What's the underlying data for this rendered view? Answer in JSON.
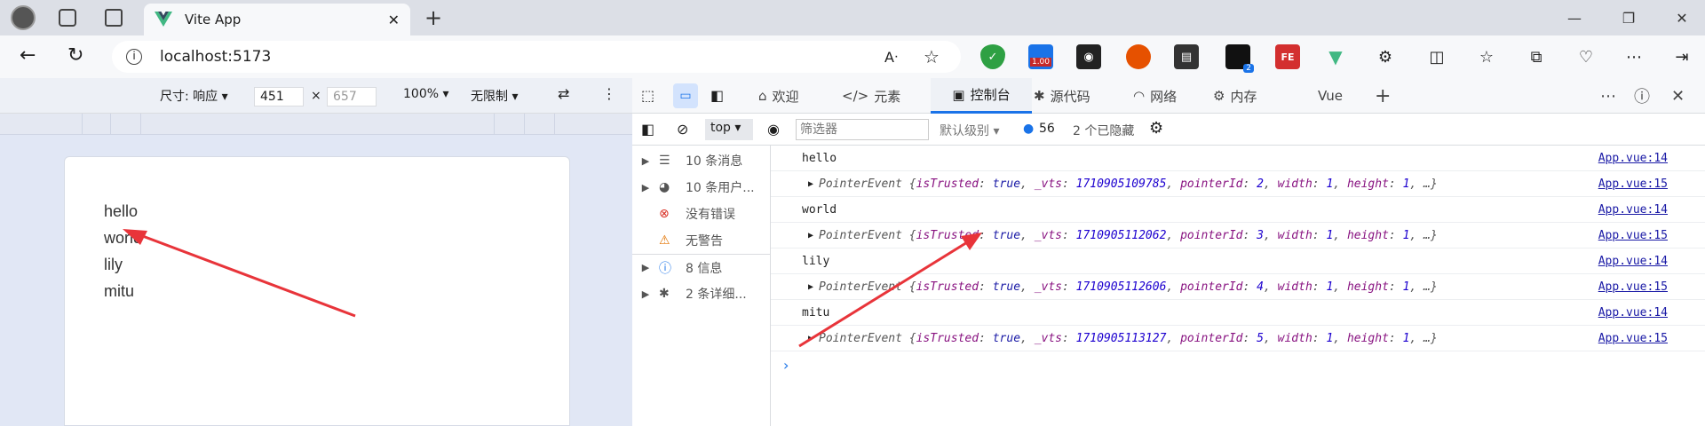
{
  "browser": {
    "tab_title": "Vite App",
    "url": "localhost:5173",
    "extension_badge_1": "1.00",
    "extension_badge_2": "2"
  },
  "device_toolbar": {
    "dimensions_label": "尺寸: 响应",
    "width": "451",
    "x_sep": "×",
    "height": "657",
    "zoom": "100%",
    "throttle": "无限制"
  },
  "page": {
    "items": [
      "hello",
      "world",
      "lily",
      "mitu"
    ]
  },
  "devtools": {
    "tabs": {
      "welcome": "欢迎",
      "elements": "元素",
      "console": "控制台",
      "sources": "源代码",
      "network": "网络",
      "memory": "内存",
      "vue": "Vue"
    },
    "console_bar": {
      "context": "top",
      "filter_placeholder": "筛选器",
      "level": "默认级别",
      "issue_count": "56",
      "hidden": "2 个已隐藏"
    },
    "sidebar": {
      "messages": "10 条消息",
      "user_messages": "10 条用户...",
      "errors": "没有错误",
      "warnings": "无警告",
      "info": "8 信息",
      "verbose": "2 条详细..."
    },
    "logs": [
      {
        "text": "hello",
        "source": "App.vue:14"
      },
      {
        "type": "PointerEvent",
        "vts": "1710905109785",
        "pointerId": "2",
        "source": "App.vue:15"
      },
      {
        "text": "world",
        "source": "App.vue:14"
      },
      {
        "type": "PointerEvent",
        "vts": "1710905112062",
        "pointerId": "3",
        "source": "App.vue:15"
      },
      {
        "text": "lily",
        "source": "App.vue:14"
      },
      {
        "type": "PointerEvent",
        "vts": "1710905112606",
        "pointerId": "4",
        "source": "App.vue:15"
      },
      {
        "text": "mitu",
        "source": "App.vue:14"
      },
      {
        "type": "PointerEvent",
        "vts": "1710905113127",
        "pointerId": "5",
        "source": "App.vue:15"
      }
    ],
    "event_keys": {
      "trusted": "isTrusted",
      "trusted_val": "true",
      "vts": "_vts",
      "pointer": "pointerId",
      "width": "width",
      "width_val": "1",
      "height": "height",
      "height_val": "1",
      "ellipsis": "…"
    }
  },
  "colors": {
    "accent": "#1a73e8",
    "arrow": "#e8343a",
    "vue_green": "#41b883"
  }
}
